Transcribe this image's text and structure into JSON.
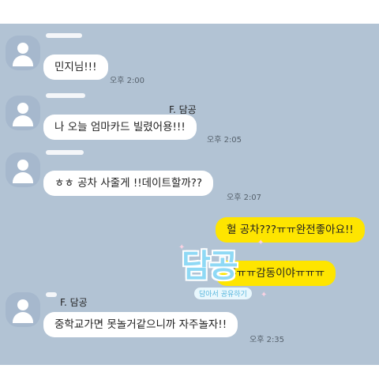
{
  "messages": {
    "m1": {
      "text": "민지님!!!",
      "time": "오후 2:00"
    },
    "m2": {
      "text": "나 오늘 엄마카드 빌렸어용!!!",
      "time": "오후 2:05",
      "overlay_name": "F. 담공"
    },
    "m3": {
      "text": "ㅎㅎ 공차 사줄게 !!데이트할까??",
      "time": "오후 2:07"
    },
    "m4": {
      "text": "헐 공차???ㅠㅠ완전좋아요!!"
    },
    "m5": {
      "text": "흑ㅠㅠ감동이야ㅠㅠㅠ"
    },
    "m6": {
      "text": "중학교가면 못놀거같으니까 자주놀자!!",
      "time": "오후 2:35",
      "sender": "F. 담공"
    }
  },
  "watermark": {
    "title": "담공",
    "subtitle": "담아서 공유하기"
  },
  "colors": {
    "background": "#b2c3d4",
    "my_bubble": "#fee500",
    "their_bubble": "#ffffff"
  }
}
